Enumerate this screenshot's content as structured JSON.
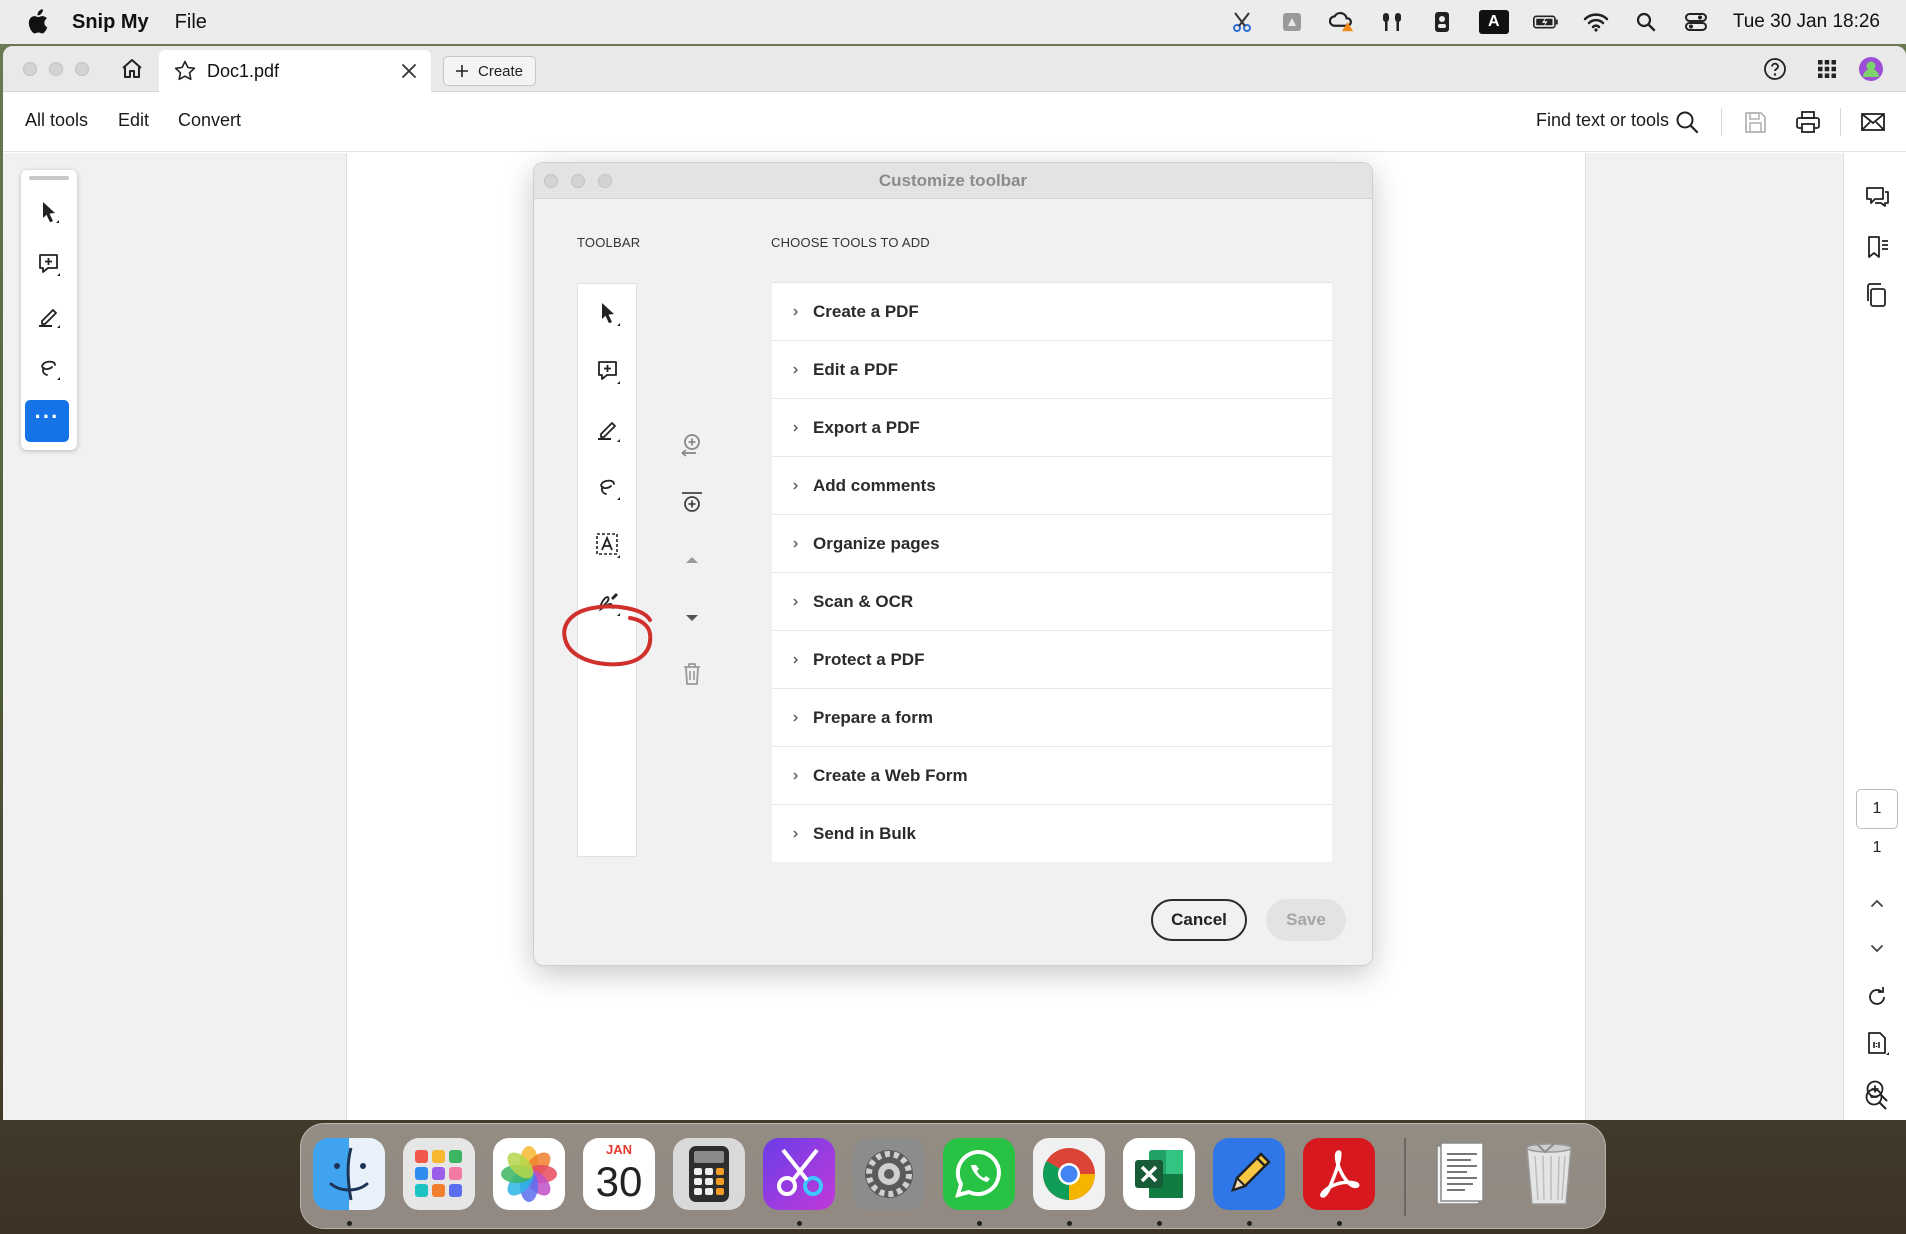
{
  "menubar": {
    "app_name": "Snip My",
    "menu_file": "File",
    "keyboard_input": "A",
    "clock": "Tue 30 Jan  18:26"
  },
  "window": {
    "tab_title": "Doc1.pdf",
    "create_label": "Create"
  },
  "appbar": {
    "all_tools": "All tools",
    "edit": "Edit",
    "convert": "Convert",
    "find": "Find text or tools"
  },
  "quick_toolbar": {
    "more_label": "···"
  },
  "right_rail": {
    "current_page": "1",
    "total_pages": "1"
  },
  "dialog": {
    "title": "Customize toolbar",
    "toolbar_label": "TOOLBAR",
    "choose_label": "CHOOSE TOOLS TO ADD",
    "tools": [
      "Create a PDF",
      "Edit a PDF",
      "Export a PDF",
      "Add comments",
      "Organize pages",
      "Scan & OCR",
      "Protect a PDF",
      "Prepare a form",
      "Create a Web Form",
      "Send in Bulk"
    ],
    "cancel_label": "Cancel",
    "save_label": "Save"
  },
  "dock": {
    "calendar_month": "JAN",
    "calendar_day": "30"
  },
  "colors": {
    "accent": "#1473e6",
    "annotation": "#d0302b",
    "acrobat_red": "#d7191f"
  }
}
